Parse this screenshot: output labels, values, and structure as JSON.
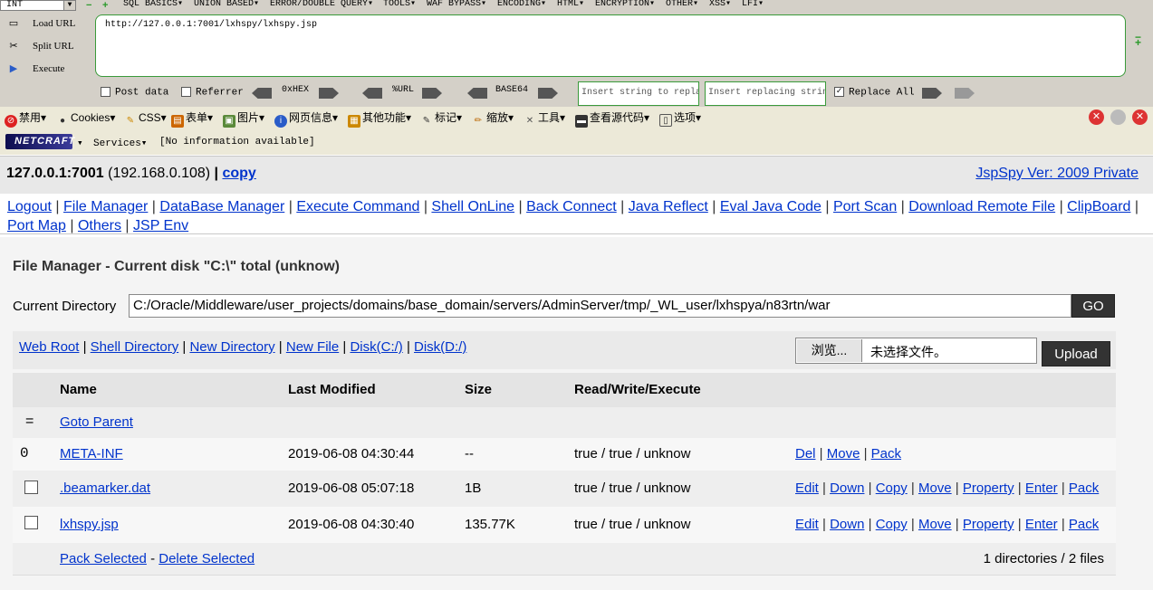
{
  "hackbar": {
    "select_value": "INT",
    "menus": [
      "SQL BASICS▾",
      "UNION BASED▾",
      "ERROR/DOUBLE QUERY▾",
      "TOOLS▾",
      "WAF BYPASS▾",
      "ENCODING▾",
      "HTML▾",
      "ENCRYPTION▾",
      "OTHER▾",
      "XSS▾",
      "LFI▾"
    ],
    "actions": [
      "Load URL",
      "Split URL",
      "Execute"
    ],
    "url": "http://127.0.0.1:7001/lxhspy/lxhspy.jsp",
    "post_data": "Post data",
    "referrer": "Referrer",
    "enc_hex": "0xHEX",
    "enc_url": "%URL",
    "enc_base64": "BASE64",
    "insert_placeholder": "Insert string to replace",
    "replacing_placeholder": "Insert replacing string",
    "replace_all": "Replace All",
    "replace_all_checked": "✓"
  },
  "webdev": {
    "items": [
      "禁用▾",
      "Cookies▾",
      "CSS▾",
      "表单▾",
      "图片▾",
      "网页信息▾",
      "其他功能▾",
      "标记▾",
      "缩放▾",
      "工具▾",
      "查看源代码▾",
      "选项▾"
    ]
  },
  "netcraft": {
    "logo": "NETCRAFT",
    "dropdown": "▾",
    "services": "Services▾",
    "info": "[No information available]"
  },
  "header": {
    "host": "127.0.0.1:7001",
    "ip": "(192.168.0.108)",
    "sep": "|",
    "copy": "copy",
    "version": "JspSpy Ver: 2009 Private"
  },
  "nav": [
    "Logout",
    "File Manager",
    "DataBase Manager",
    "Execute Command",
    "Shell OnLine",
    "Back Connect",
    "Java Reflect",
    "Eval Java Code",
    "Port Scan",
    "Download Remote File",
    "ClipBoard",
    "Port Map",
    "Others",
    "JSP Env"
  ],
  "file_manager": {
    "title": "File Manager - Current disk \"C:\\\" total (unknow)",
    "current_dir_label": "Current Directory",
    "current_dir": "C:/Oracle/Middleware/user_projects/domains/base_domain/servers/AdminServer/tmp/_WL_user/lxhspya/n83rtn/war",
    "go": "GO",
    "quick_links": [
      "Web Root",
      "Shell Directory",
      "New Directory",
      "New File",
      "Disk(C:/)",
      "Disk(D:/)"
    ],
    "browse": "浏览...",
    "no_file": "未选择文件。",
    "upload": "Upload"
  },
  "table": {
    "headers": [
      "Name",
      "Last Modified",
      "Size",
      "Read/Write/Execute"
    ],
    "parent_symbol": "=",
    "goto_parent": "Goto Parent",
    "rows": [
      {
        "marker": "0",
        "name": "META-INF",
        "modified": "2019-06-08 04:30:44",
        "size": "--",
        "rwx": "true / true / unknow",
        "actions": [
          "Del",
          "Move",
          "Pack"
        ]
      },
      {
        "name": ".beamarker.dat",
        "modified": "2019-06-08 05:07:18",
        "size": "1B",
        "rwx": "true / true / unknow",
        "actions": [
          "Edit",
          "Down",
          "Copy",
          "Move",
          "Property",
          "Enter",
          "Pack"
        ]
      },
      {
        "name": "lxhspy.jsp",
        "modified": "2019-06-08 04:30:40",
        "size": "135.77K",
        "rwx": "true / true / unknow",
        "actions": [
          "Edit",
          "Down",
          "Copy",
          "Move",
          "Property",
          "Enter",
          "Pack"
        ]
      }
    ],
    "pack_selected": "Pack Selected",
    "dash": "-",
    "delete_selected": "Delete Selected",
    "summary": "1 directories / 2 files"
  }
}
